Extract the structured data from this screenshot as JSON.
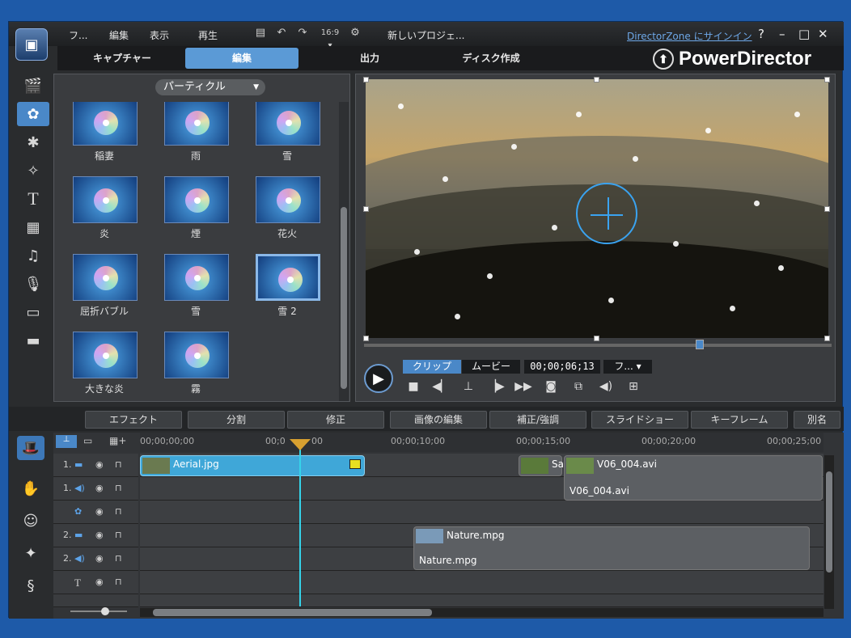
{
  "menu": {
    "items": [
      "フ...",
      "編集",
      "表示",
      "再生"
    ]
  },
  "toolbar": {
    "aspect": "16:9 ▾"
  },
  "project_title": "新しいプロジェ...",
  "signin": "DirectorZone にサインイン",
  "window": {
    "help": "?",
    "minimize": "–",
    "maximize": "□",
    "close": "✕"
  },
  "modes": {
    "capture": "キャプチャー",
    "edit": "編集",
    "produce": "出力",
    "disc": "ディスク作成"
  },
  "brand": "PowerDirector",
  "library": {
    "category": "パーティクル",
    "items": [
      "稲妻",
      "雨",
      "雪",
      "炎",
      "煙",
      "花火",
      "屈折バブル",
      "雪",
      "雪 2",
      "大きな炎",
      "霧"
    ]
  },
  "player": {
    "clip_tab": "クリップ",
    "movie_tab": "ムービー",
    "timecode": "00;00;06;13",
    "fit": "フ...",
    "progress": 0.71
  },
  "actions": [
    "エフェクト",
    "分割",
    "修正",
    "画像の編集",
    "補正/強調",
    "スライドショー",
    "キーフレーム",
    "別名"
  ],
  "timeline": {
    "ticks": [
      "00;00;00;00",
      "00;0",
      "00",
      "00;00;10;00",
      "00;00;15;00",
      "00;00;20;00",
      "00;00;25;00"
    ],
    "track_labels": [
      "1.",
      "1.",
      "",
      "2.",
      "2.",
      "",
      ""
    ],
    "clips": {
      "aerial": "Aerial.jpg",
      "sa": "Sa",
      "v06": "V06_004.avi",
      "v06_audio": "V06_004.avi",
      "nature": "Nature.mpg",
      "nature_audio": "Nature.mpg"
    }
  }
}
